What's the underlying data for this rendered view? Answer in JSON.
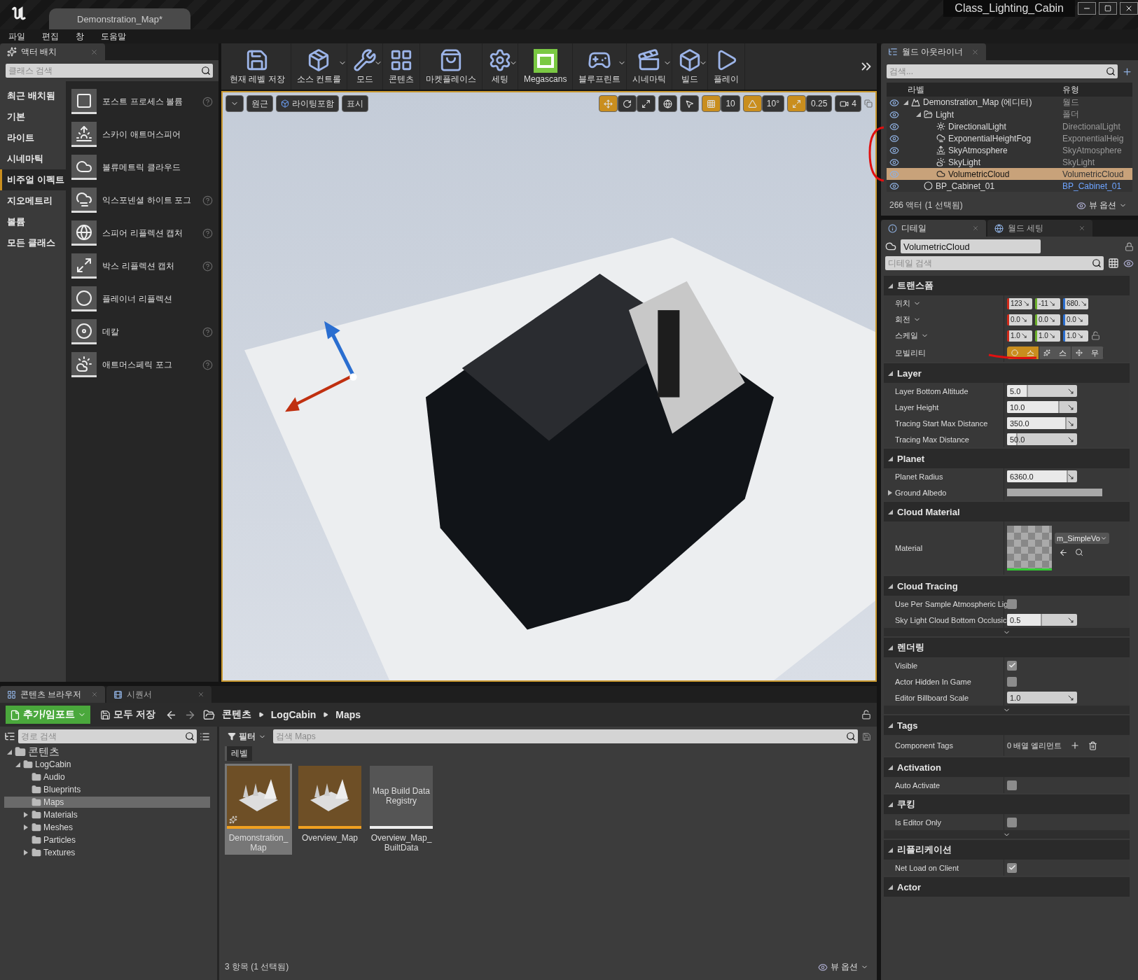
{
  "title_bar": {
    "tab": "Demonstration_Map*",
    "project": "Class_Lighting_Cabin"
  },
  "menu": [
    "파일",
    "편집",
    "창",
    "도움말"
  ],
  "place_actors": {
    "tab": "액터 배치",
    "search_placeholder": "클래스 검색",
    "categories": [
      {
        "label": "최근 배치됨",
        "selected": false
      },
      {
        "label": "기본",
        "selected": false
      },
      {
        "label": "라이트",
        "selected": false
      },
      {
        "label": "시네마틱",
        "selected": false
      },
      {
        "label": "비주얼 이펙트",
        "selected": true
      },
      {
        "label": "지오메트리",
        "selected": false
      },
      {
        "label": "볼륨",
        "selected": false
      },
      {
        "label": "모든 클래스",
        "selected": false
      }
    ],
    "items": [
      {
        "label": "포스트 프로세스 볼륨",
        "help": true
      },
      {
        "label": "스카이 애트머스피어",
        "help": false
      },
      {
        "label": "볼류메트릭 클라우드",
        "help": false
      },
      {
        "label": "익스포넨셜 하이트 포그",
        "help": true
      },
      {
        "label": "스피어 리플렉션 캡처",
        "help": true
      },
      {
        "label": "박스 리플렉션 캡처",
        "help": true
      },
      {
        "label": "플레이너 리플렉션",
        "help": false
      },
      {
        "label": "데칼",
        "help": true
      },
      {
        "label": "애트머스페릭 포그",
        "help": true
      }
    ]
  },
  "toolbar": [
    {
      "label": "현재 레벨 저장",
      "dropdown": false
    },
    {
      "label": "소스 컨트롤",
      "dropdown": true
    },
    {
      "label": "모드",
      "dropdown": true
    },
    {
      "label": "콘텐츠",
      "dropdown": false
    },
    {
      "label": "마켓플레이스",
      "dropdown": false
    },
    {
      "label": "세팅",
      "dropdown": true
    },
    {
      "label": "Megascans",
      "dropdown": false
    },
    {
      "label": "블루프린트",
      "dropdown": true
    },
    {
      "label": "시네마틱",
      "dropdown": true
    },
    {
      "label": "빌드",
      "dropdown": true
    },
    {
      "label": "플레이",
      "dropdown": false
    }
  ],
  "viewport": {
    "left_buttons": [
      "원근",
      "라이팅포함",
      "표시"
    ],
    "transform_modes": [
      {
        "selected": true
      },
      {
        "selected": false
      },
      {
        "selected": false
      }
    ],
    "snaps": [
      {
        "value": "10",
        "on": true
      },
      {
        "value": "10°",
        "on": true
      },
      {
        "value": "0.25",
        "on": true
      }
    ],
    "camera_speed": "4"
  },
  "outliner": {
    "tab": "월드 아웃라이너",
    "search_placeholder": "검색...",
    "columns": [
      "라벨",
      "유형"
    ],
    "rows": [
      {
        "kind": "world",
        "label": "Demonstration_Map (에디터)",
        "type": "월드",
        "visible": true,
        "selected": false,
        "expanded": true,
        "children": [
          {
            "kind": "folder",
            "label": "Light",
            "type": "폴더",
            "visible": true,
            "selected": false,
            "expanded": true,
            "children": [
              {
                "kind": "directional",
                "label": "DirectionalLight",
                "type": "DirectionalLight",
                "visible": true,
                "selected": false,
                "expanded": false
              },
              {
                "kind": "fog",
                "label": "ExponentialHeightFog",
                "type": "ExponentialHeig",
                "visible": true,
                "selected": false,
                "expanded": false
              },
              {
                "kind": "atmosphere",
                "label": "SkyAtmosphere",
                "type": "SkyAtmosphere",
                "visible": true,
                "selected": false,
                "expanded": false
              },
              {
                "kind": "skylight",
                "label": "SkyLight",
                "type": "SkyLight",
                "visible": true,
                "selected": false,
                "expanded": false
              },
              {
                "kind": "cloud",
                "label": "VolumetricCloud",
                "type": "VolumetricCloud",
                "visible": true,
                "selected": true,
                "expanded": false
              }
            ]
          },
          {
            "kind": "blueprint",
            "label": "BP_Cabinet_01",
            "type": "BP_Cabinet_01",
            "visible": true,
            "selected": false,
            "expanded": false
          }
        ]
      }
    ],
    "status": "266 액터 (1 선택됨)",
    "view_options": "뷰 옵션"
  },
  "details": {
    "tabs": [
      {
        "label": "디테일",
        "selected": true
      },
      {
        "label": "월드 세팅",
        "selected": false
      }
    ],
    "actor_name": "VolumetricCloud",
    "search_placeholder": "디테일 검색",
    "sections": [
      {
        "title": "트랜스폼",
        "rows": [
          {
            "kind": "vector",
            "label": "위치",
            "values": [
              "123",
              "-11",
              "680."
            ]
          },
          {
            "kind": "vector",
            "label": "회전",
            "values": [
              "0.0",
              "0.0",
              "0.0"
            ]
          },
          {
            "kind": "vector",
            "label": "스케일",
            "values": [
              "1.0",
              "1.0",
              "1.0"
            ],
            "lock": true
          },
          {
            "kind": "mobility",
            "label": "모빌리티",
            "options": [
              {
                "label": "스",
                "selected": true
              },
              {
                "label": "스",
                "selected": false
              },
              {
                "label": "무",
                "selected": false
              }
            ]
          }
        ]
      },
      {
        "title": "Layer",
        "rows": [
          {
            "kind": "slider",
            "label": "Layer Bottom Altitude",
            "value": "5.0",
            "level": 0.3
          },
          {
            "kind": "slider",
            "label": "Layer Height",
            "value": "10.0",
            "level": 0.75
          },
          {
            "kind": "slider",
            "label": "Tracing Start Max Distance",
            "value": "350.0",
            "level": 0.85
          },
          {
            "kind": "slider",
            "label": "Tracing Max Distance",
            "value": "50.0",
            "level": 0.15
          }
        ]
      },
      {
        "title": "Planet",
        "rows": [
          {
            "kind": "slider",
            "label": "Planet Radius",
            "value": "6360.0",
            "level": 0.87
          },
          {
            "kind": "color",
            "label": "Ground Albedo",
            "expanded": false,
            "color": "#a8a8a8"
          }
        ]
      },
      {
        "title": "Cloud Material",
        "rows": [
          {
            "kind": "material",
            "label": "Material",
            "value": "m_SimpleVo"
          }
        ]
      },
      {
        "title": "Cloud Tracing",
        "advanced": true,
        "rows": [
          {
            "kind": "checkbox",
            "label": "Use Per Sample Atmospheric Lig",
            "checked": false
          },
          {
            "kind": "slider",
            "label": "Sky Light Cloud Bottom Occlusic",
            "value": "0.5",
            "level": 0.5
          }
        ]
      },
      {
        "title": "렌더링",
        "advanced": true,
        "rows": [
          {
            "kind": "checkbox",
            "label": "Visible",
            "checked": true
          },
          {
            "kind": "checkbox",
            "label": "Actor Hidden In Game",
            "checked": false
          },
          {
            "kind": "number",
            "label": "Editor Billboard Scale",
            "value": "1.0"
          }
        ]
      },
      {
        "title": "Tags",
        "rows": [
          {
            "kind": "array",
            "label": "Component Tags",
            "value": "0 배열 엘리먼트"
          }
        ]
      },
      {
        "title": "Activation",
        "rows": [
          {
            "kind": "checkbox",
            "label": "Auto Activate",
            "checked": false
          }
        ]
      },
      {
        "title": "쿠킹",
        "advanced": true,
        "rows": [
          {
            "kind": "checkbox",
            "label": "Is Editor Only",
            "checked": false
          }
        ]
      },
      {
        "title": "리플리케이션",
        "rows": [
          {
            "kind": "checkbox",
            "label": "Net Load on Client",
            "checked": true
          }
        ]
      },
      {
        "title": "Actor"
      }
    ]
  },
  "content_browser": {
    "tabs": [
      {
        "label": "콘텐츠 브라우저",
        "selected": true
      },
      {
        "label": "시퀀서",
        "selected": false
      }
    ],
    "add_import": "추가/임포트",
    "save_all": "모두 저장",
    "breadcrumb": [
      "콘텐츠",
      "LogCabin",
      "Maps"
    ],
    "path_search_placeholder": "경로 검색",
    "tree": [
      {
        "label": "콘텐츠",
        "expanded": true,
        "selected": false,
        "children": [
          {
            "label": "LogCabin",
            "expanded": true,
            "selected": false,
            "children": [
              {
                "label": "Audio",
                "selected": false
              },
              {
                "label": "Blueprints",
                "selected": false
              },
              {
                "label": "Maps",
                "selected": true
              },
              {
                "label": "Materials",
                "expanded": false,
                "selected": false
              },
              {
                "label": "Meshes",
                "expanded": false,
                "selected": false
              },
              {
                "label": "Particles",
                "selected": false
              },
              {
                "label": "Textures",
                "expanded": false,
                "selected": false
              }
            ]
          }
        ]
      }
    ],
    "filter": "필터",
    "search_placeholder": "검색 Maps",
    "filter_chip": "레벨",
    "assets": [
      {
        "kind": "map",
        "name": "Demonstration_Map",
        "selected": true,
        "dirty": true
      },
      {
        "kind": "map",
        "name": "Overview_Map",
        "selected": false,
        "dirty": false
      },
      {
        "kind": "data",
        "name": "Overview_Map_BuiltData",
        "thumb_text": "Map Build Data Registry",
        "selected": false,
        "dirty": false
      }
    ],
    "status": "3 항목 (1 선택됨)",
    "view_options": "뷰 옵션"
  }
}
